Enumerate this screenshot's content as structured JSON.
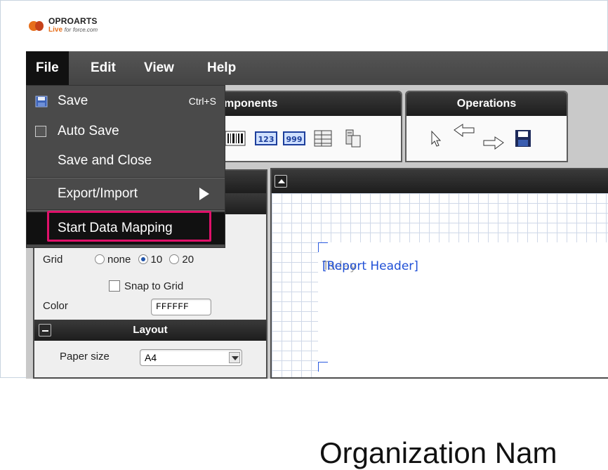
{
  "logo": {
    "brand": "OPROARTS",
    "live": "Live",
    "for": "for",
    "force": "force.com"
  },
  "menubar": {
    "items": [
      "File",
      "Edit",
      "View",
      "Help"
    ]
  },
  "file_menu": {
    "save": "Save",
    "save_shortcut": "Ctrl+S",
    "auto_save": "Auto Save",
    "save_and_close": "Save and Close",
    "export_import": "Export/Import",
    "start_data_mapping": "Start Data Mapping"
  },
  "toolbox": {
    "components_title": "mponents",
    "operations_title": "Operations"
  },
  "properties": {
    "grid_label": "Grid",
    "grid_options": [
      "none",
      "10",
      "20"
    ],
    "grid_selected": "10",
    "snap_label": "Snap to Grid",
    "color_label": "Color",
    "color_value": "FFFFFF",
    "layout_title": "Layout",
    "paper_size_label": "Paper size",
    "paper_size_value": "A4"
  },
  "canvas": {
    "band_label": "[Report Header]",
    "overlap_label": "Today",
    "org_text": "Organization Nam"
  },
  "colors": {
    "highlight_box": "#e0116a",
    "band_text": "#1f4fd6"
  }
}
